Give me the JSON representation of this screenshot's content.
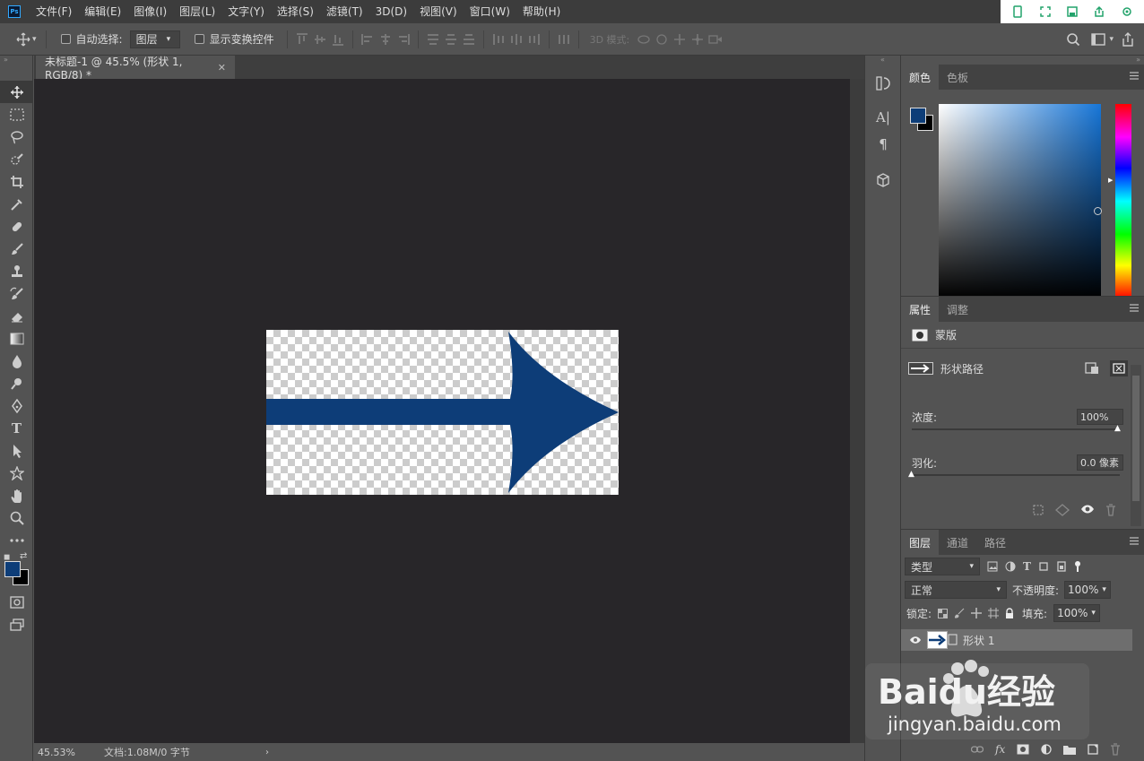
{
  "menu": [
    "文件(F)",
    "编辑(E)",
    "图像(I)",
    "图层(L)",
    "文字(Y)",
    "选择(S)",
    "滤镜(T)",
    "3D(D)",
    "视图(V)",
    "窗口(W)",
    "帮助(H)"
  ],
  "app_logo": "Ps",
  "options": {
    "auto_select_label": "自动选择:",
    "auto_select_value": "图层",
    "show_transform_label": "显示变换控件",
    "mode_3d_label": "3D 模式:"
  },
  "document": {
    "tab_title": "未标题-1 @ 45.5% (形状 1, RGB/8) *",
    "zoom": "45.53%",
    "info": "文档:1.08M/0 字节",
    "arrow_color": "#0d3d78"
  },
  "color_panel": {
    "tabs": [
      "颜色",
      "色板"
    ],
    "foreground": "#0d3d78",
    "background": "#000000"
  },
  "properties_panel": {
    "tabs": [
      "属性",
      "调整"
    ],
    "section": "蒙版",
    "path_label": "形状路径",
    "density_label": "浓度:",
    "density_value": "100%",
    "feather_label": "羽化:",
    "feather_value": "0.0 像素"
  },
  "layers_panel": {
    "tabs": [
      "图层",
      "通道",
      "路径"
    ],
    "filter_label": "类型",
    "blend_mode": "正常",
    "opacity_label": "不透明度:",
    "opacity_value": "100%",
    "lock_label": "锁定:",
    "fill_label": "填充:",
    "fill_value": "100%",
    "layers": [
      {
        "name": "形状 1"
      }
    ]
  },
  "watermark": {
    "brand": "Baidu经验",
    "url": "jingyan.baidu.com"
  }
}
